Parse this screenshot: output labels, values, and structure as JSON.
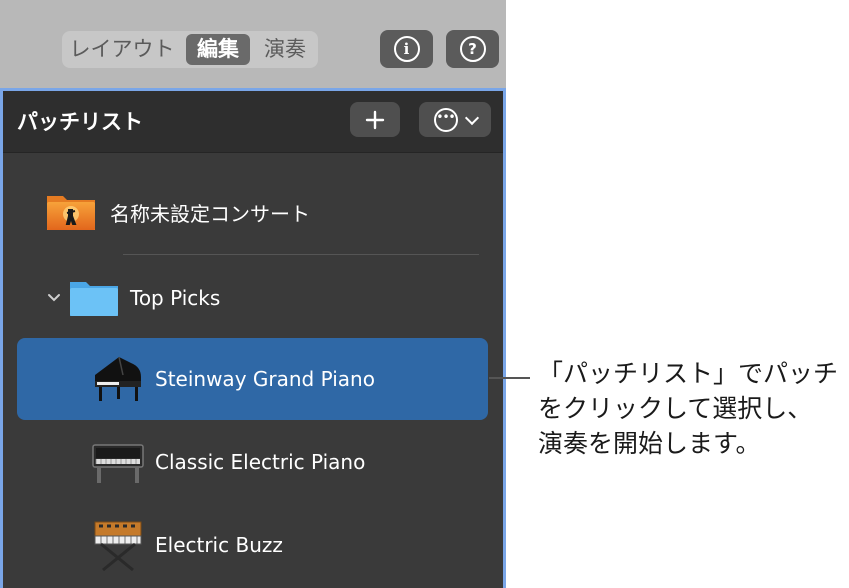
{
  "toolbar": {
    "tabs": [
      {
        "label": "レイアウト",
        "active": false
      },
      {
        "label": "編集",
        "active": true
      },
      {
        "label": "演奏",
        "active": false
      }
    ],
    "info_icon": "info-icon",
    "help_icon": "help-icon"
  },
  "panel": {
    "title": "パッチリスト",
    "add_icon": "plus-icon",
    "more_icon": "ellipsis-circle-icon"
  },
  "list": {
    "concert": {
      "label": "名称未設定コンサート",
      "icon": "concert-folder-icon"
    },
    "folder": {
      "label": "Top Picks",
      "icon": "folder-icon",
      "expanded": true
    },
    "patches": [
      {
        "label": "Steinway Grand Piano",
        "icon": "grand-piano-icon",
        "selected": true
      },
      {
        "label": "Classic Electric Piano",
        "icon": "electric-piano-icon",
        "selected": false
      },
      {
        "label": "Electric Buzz",
        "icon": "synthesizer-icon",
        "selected": false
      }
    ]
  },
  "callout": {
    "text": "「パッチリスト」でパッチをクリックして選択し、演奏を開始します。",
    "line1": "「パッチリスト」でパッチ",
    "line2": "をクリックして選択し、",
    "line3": "演奏を開始します。"
  },
  "colors": {
    "selection": "#2f68a6",
    "focus_ring": "#7aa6e8",
    "folder_blue": "#5ab6f2",
    "concert_orange": "#f08c2a"
  }
}
